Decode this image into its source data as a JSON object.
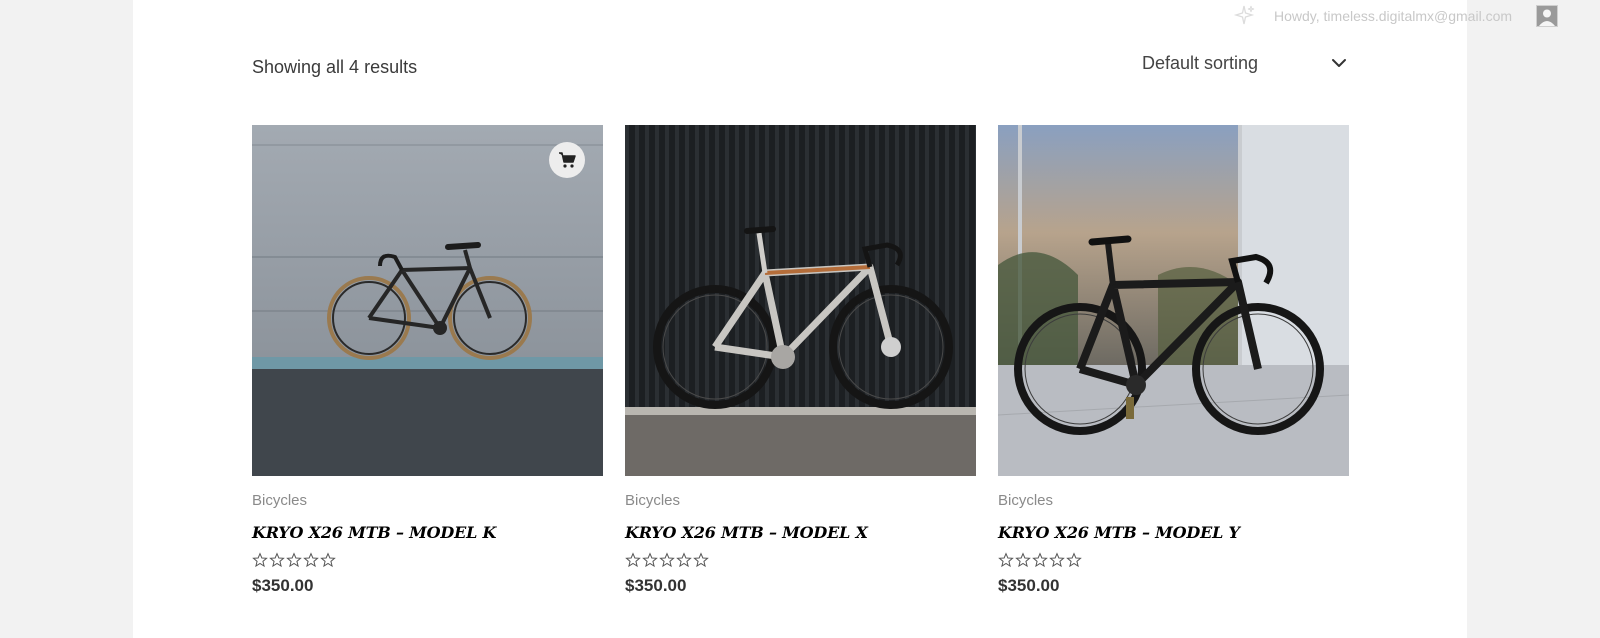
{
  "adminbar": {
    "greeting": "Howdy, timeless.digitalmx@gmail.com"
  },
  "shop": {
    "result_count": "Showing all 4 results",
    "sorting": {
      "selected": "Default sorting"
    }
  },
  "products": [
    {
      "category": "Bicycles",
      "title": "KRYO X26 MTB – MODEL K",
      "rating": 0,
      "price": "$350.00"
    },
    {
      "category": "Bicycles",
      "title": "KRYO X26 MTB – MODEL X",
      "rating": 0,
      "price": "$350.00"
    },
    {
      "category": "Bicycles",
      "title": "KRYO X26 MTB – MODEL Y",
      "rating": 0,
      "price": "$350.00"
    }
  ],
  "icons": {
    "cart": "cart-icon",
    "chevron": "chevron-down-icon",
    "star": "star-outline-icon",
    "sparkle": "sparkle-icon",
    "avatar": "avatar"
  }
}
